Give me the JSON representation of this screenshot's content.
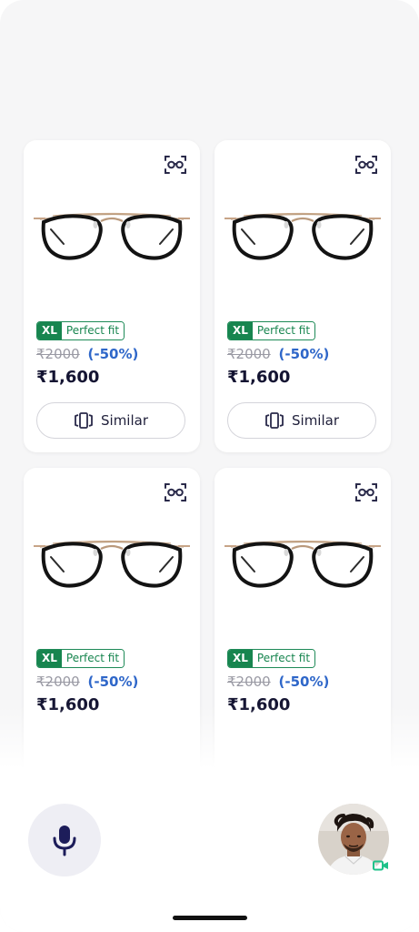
{
  "products": [
    {
      "fit_size": "XL",
      "fit_label": "Perfect fit",
      "mrp": "₹2000",
      "discount": "(-50%)",
      "price": "₹1,600",
      "similar_label": "Similar"
    },
    {
      "fit_size": "XL",
      "fit_label": "Perfect fit",
      "mrp": "₹2000",
      "discount": "(-50%)",
      "price": "₹1,600",
      "similar_label": "Similar"
    },
    {
      "fit_size": "XL",
      "fit_label": "Perfect fit",
      "mrp": "₹2000",
      "discount": "(-50%)",
      "price": "₹1,600"
    },
    {
      "fit_size": "XL",
      "fit_label": "Perfect fit",
      "mrp": "₹2000",
      "discount": "(-50%)",
      "price": "₹1,600"
    }
  ],
  "icons": {
    "try_on": "face-glasses-icon",
    "similar": "similar-frames-icon",
    "mic": "microphone-icon",
    "video": "video-camera-icon"
  },
  "colors": {
    "fit_green": "#17854f",
    "discount_blue": "#2f67c9",
    "price_dark": "#141432",
    "video_green": "#1fc28a"
  }
}
